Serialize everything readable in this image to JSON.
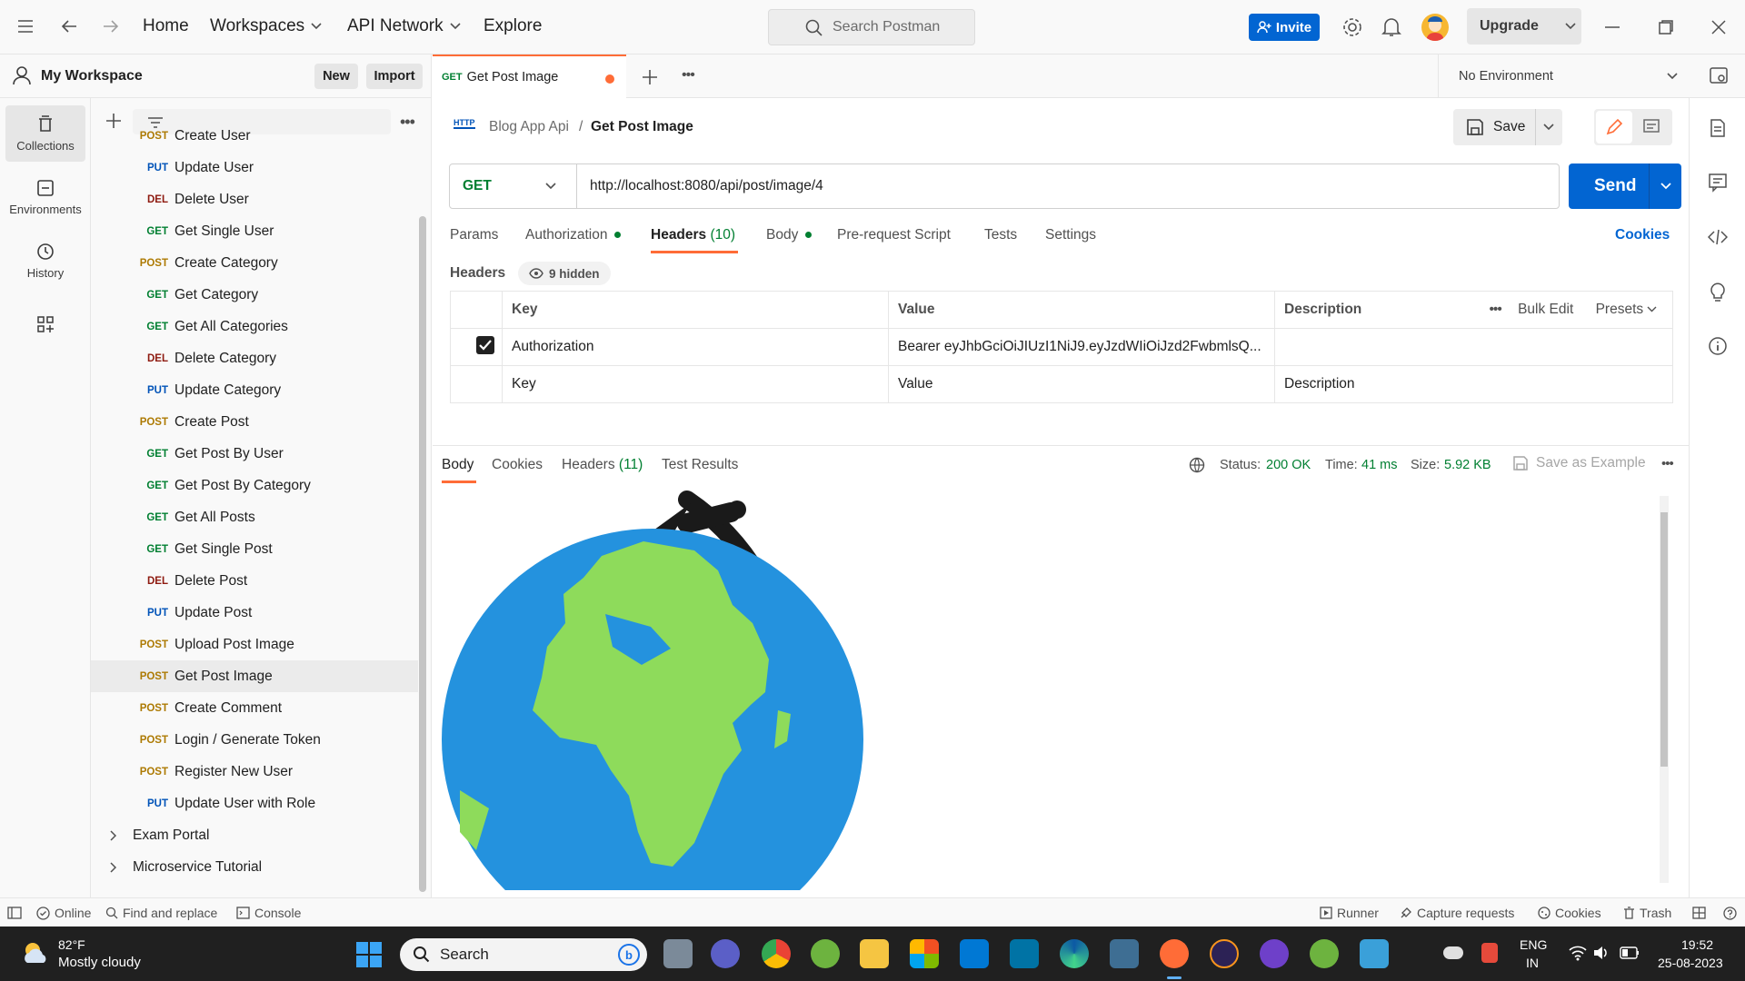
{
  "topbar": {
    "home": "Home",
    "workspaces": "Workspaces",
    "api_network": "API Network",
    "explore": "Explore",
    "search_placeholder": "Search Postman",
    "invite": "Invite",
    "upgrade": "Upgrade"
  },
  "workspace": {
    "name": "My Workspace",
    "new": "New",
    "import": "Import"
  },
  "rail": {
    "collections": "Collections",
    "environments": "Environments",
    "history": "History"
  },
  "requests": [
    {
      "method": "POST",
      "name": "Create User"
    },
    {
      "method": "PUT",
      "name": "Update User"
    },
    {
      "method": "DEL",
      "name": "Delete User"
    },
    {
      "method": "GET",
      "name": "Get Single User"
    },
    {
      "method": "POST",
      "name": "Create Category"
    },
    {
      "method": "GET",
      "name": "Get Category"
    },
    {
      "method": "GET",
      "name": "Get All Categories"
    },
    {
      "method": "DEL",
      "name": "Delete Category"
    },
    {
      "method": "PUT",
      "name": "Update Category"
    },
    {
      "method": "POST",
      "name": "Create Post"
    },
    {
      "method": "GET",
      "name": "Get Post By User"
    },
    {
      "method": "GET",
      "name": "Get Post By Category"
    },
    {
      "method": "GET",
      "name": "Get All Posts"
    },
    {
      "method": "GET",
      "name": "Get Single Post"
    },
    {
      "method": "DEL",
      "name": "Delete Post"
    },
    {
      "method": "PUT",
      "name": "Update Post"
    },
    {
      "method": "POST",
      "name": "Upload Post Image"
    },
    {
      "method": "POST",
      "name": "Get Post Image"
    },
    {
      "method": "POST",
      "name": "Create Comment"
    },
    {
      "method": "POST",
      "name": "Login / Generate Token"
    },
    {
      "method": "POST",
      "name": "Register New User"
    },
    {
      "method": "PUT",
      "name": "Update User with Role"
    }
  ],
  "folders": [
    "Exam Portal",
    "Microservice Tutorial"
  ],
  "tab": {
    "method": "GET",
    "name": "Get Post Image"
  },
  "environment": "No Environment",
  "breadcrumb": {
    "collection": "Blog App Api",
    "sep": "/",
    "request": "Get Post Image"
  },
  "save": "Save",
  "request": {
    "method": "GET",
    "url": "http://localhost:8080/api/post/image/4",
    "send": "Send"
  },
  "req_tabs": {
    "params": "Params",
    "authorization": "Authorization",
    "headers": "Headers",
    "headers_count": "(10)",
    "body": "Body",
    "prerequest": "Pre-request Script",
    "tests": "Tests",
    "settings": "Settings",
    "cookies": "Cookies"
  },
  "headers_section": {
    "title": "Headers",
    "hidden": "9 hidden"
  },
  "headers_table": {
    "key": "Key",
    "value": "Value",
    "description": "Description",
    "bulk_edit": "Bulk Edit",
    "presets": "Presets",
    "row": {
      "key": "Authorization",
      "value": "Bearer eyJhbGciOiJIUzI1NiJ9.eyJzdWIiOiJzd2FwbmlsQ..."
    },
    "placeholder": {
      "key": "Key",
      "value": "Value",
      "description": "Description"
    }
  },
  "response": {
    "tabs": {
      "body": "Body",
      "cookies": "Cookies",
      "headers": "Headers",
      "headers_count": "(11)",
      "test_results": "Test Results"
    },
    "status_label": "Status:",
    "status": "200 OK",
    "time_label": "Time:",
    "time": "41 ms",
    "size_label": "Size:",
    "size": "5.92 KB",
    "save_example": "Save as Example"
  },
  "statusbar": {
    "online": "Online",
    "find_replace": "Find and replace",
    "console": "Console",
    "runner": "Runner",
    "capture": "Capture requests",
    "cookies": "Cookies",
    "trash": "Trash"
  },
  "taskbar": {
    "temp": "82°F",
    "weather": "Mostly cloudy",
    "search": "Search",
    "lang1": "ENG",
    "lang2": "IN",
    "time": "19:52",
    "date": "25-08-2023"
  },
  "colors": {
    "accent": "#0265d2",
    "postman_orange": "#ff6c37",
    "status_ok": "#007f31"
  }
}
